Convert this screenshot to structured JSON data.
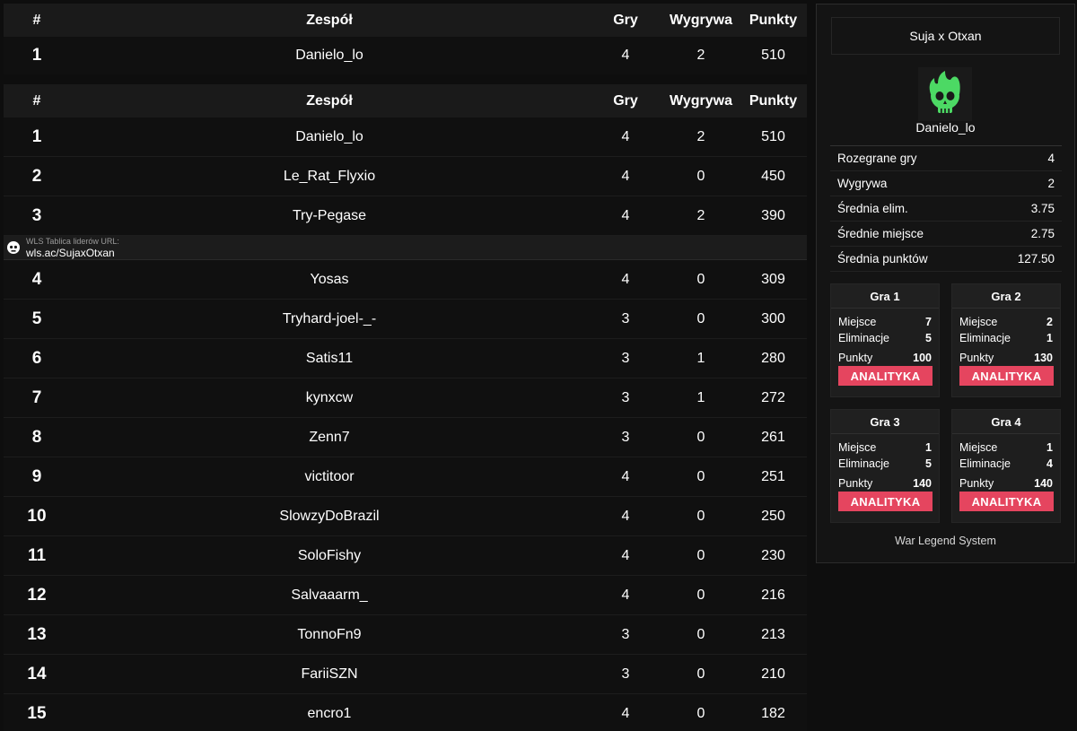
{
  "header": {
    "rank": "#",
    "team": "Zespół",
    "games": "Gry",
    "wins": "Wygrywa",
    "points": "Punkty"
  },
  "pinned_row": {
    "rank": "1",
    "team": "Danielo_lo",
    "games": "4",
    "wins": "2",
    "points": "510"
  },
  "rows_top": [
    {
      "rank": "1",
      "team": "Danielo_lo",
      "games": "4",
      "wins": "2",
      "points": "510"
    },
    {
      "rank": "2",
      "team": "Le_Rat_Flyxio",
      "games": "4",
      "wins": "0",
      "points": "450"
    },
    {
      "rank": "3",
      "team": "Try-Pegase",
      "games": "4",
      "wins": "2",
      "points": "390"
    }
  ],
  "banner": {
    "caption": "WLS Tablica liderów URL:",
    "url": "wls.ac/SujaxOtxan"
  },
  "rows_bottom": [
    {
      "rank": "4",
      "team": "Yosas",
      "games": "4",
      "wins": "0",
      "points": "309"
    },
    {
      "rank": "5",
      "team": "Tryhard-joel-_-",
      "games": "3",
      "wins": "0",
      "points": "300"
    },
    {
      "rank": "6",
      "team": "Satis11",
      "games": "3",
      "wins": "1",
      "points": "280"
    },
    {
      "rank": "7",
      "team": "kynxcw",
      "games": "3",
      "wins": "1",
      "points": "272"
    },
    {
      "rank": "8",
      "team": "Zenn7",
      "games": "3",
      "wins": "0",
      "points": "261"
    },
    {
      "rank": "9",
      "team": "victitoor",
      "games": "4",
      "wins": "0",
      "points": "251"
    },
    {
      "rank": "10",
      "team": "SlowzyDoBrazil",
      "games": "4",
      "wins": "0",
      "points": "250"
    },
    {
      "rank": "11",
      "team": "SoloFishy",
      "games": "4",
      "wins": "0",
      "points": "230"
    },
    {
      "rank": "12",
      "team": "Salvaaarm_",
      "games": "4",
      "wins": "0",
      "points": "216"
    },
    {
      "rank": "13",
      "team": "TonnoFn9",
      "games": "3",
      "wins": "0",
      "points": "213"
    },
    {
      "rank": "14",
      "team": "FariiSZN",
      "games": "3",
      "wins": "0",
      "points": "210"
    },
    {
      "rank": "15",
      "team": "encro1",
      "games": "4",
      "wins": "0",
      "points": "182"
    }
  ],
  "panel": {
    "title": "Suja x Otxan",
    "team_name": "Danielo_lo",
    "logo_icon": "flaming-skull-icon",
    "logo_color": "#4cd964",
    "stats": [
      {
        "label": "Rozegrane gry",
        "value": "4"
      },
      {
        "label": "Wygrywa",
        "value": "2"
      },
      {
        "label": "Średnia elim.",
        "value": "3.75"
      },
      {
        "label": "Średnie miejsce",
        "value": "2.75"
      },
      {
        "label": "Średnia punktów",
        "value": "127.50"
      }
    ],
    "place_label": "Miejsce",
    "elims_label": "Eliminacje",
    "points_label": "Punkty",
    "button_label": "ANALITYKA",
    "button_color": "#e5455f",
    "games": [
      {
        "title": "Gra 1",
        "place": "7",
        "elims": "5",
        "points": "100"
      },
      {
        "title": "Gra 2",
        "place": "2",
        "elims": "1",
        "points": "130"
      },
      {
        "title": "Gra 3",
        "place": "1",
        "elims": "5",
        "points": "140"
      },
      {
        "title": "Gra 4",
        "place": "1",
        "elims": "4",
        "points": "140"
      }
    ],
    "footer": "War Legend System"
  }
}
